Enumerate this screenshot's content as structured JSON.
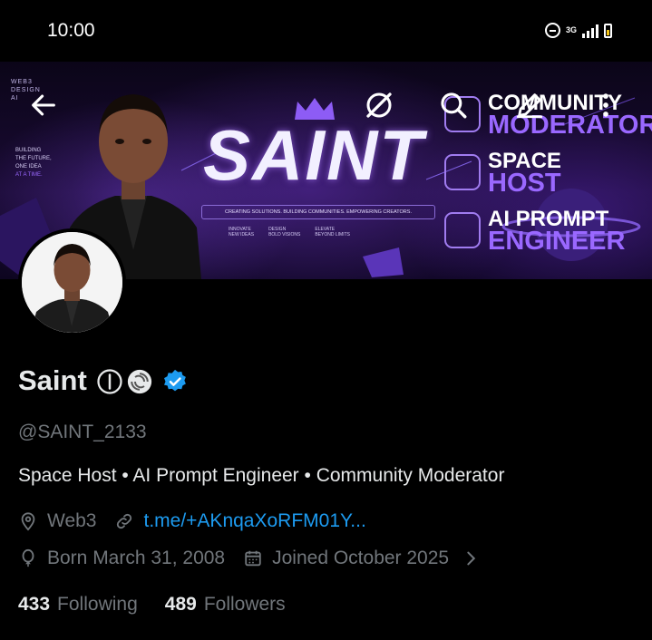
{
  "status_bar": {
    "time": "10:00",
    "network": "3G"
  },
  "banner": {
    "brand_small": [
      "WEB3",
      "DESIGN",
      "AI"
    ],
    "tagline_left": [
      "BUILDING",
      "THE FUTURE,",
      "ONE IDEA",
      "AT A TIME."
    ],
    "title": "SAINT",
    "tagline": "CREATING SOLUTIONS. BUILDING COMMUNITIES. EMPOWERING CREATORS.",
    "features": [
      {
        "top": "INNOVATE",
        "bottom": "NEW IDEAS"
      },
      {
        "top": "DESIGN",
        "bottom": "BOLD VISIONS"
      },
      {
        "top": "ELEVATE",
        "bottom": "BEYOND LIMITS"
      }
    ],
    "roles": [
      {
        "line1": "COMMUNITY",
        "line2": "MODERATOR"
      },
      {
        "line1": "SPACE",
        "line2": "HOST"
      },
      {
        "line1": "AI PROMPT",
        "line2": "ENGINEER"
      }
    ]
  },
  "profile": {
    "display_name": "Saint",
    "handle": "@SAINT_2133",
    "bio": "Space Host • AI Prompt Engineer • Community Moderator",
    "location": "Web3",
    "link": "t.me/+AKnqaXoRFM01Y...",
    "birthday": "Born March 31, 2008",
    "joined": "Joined October 2025",
    "following_count": "433",
    "following_label": "Following",
    "followers_count": "489",
    "followers_label": "Followers"
  },
  "colors": {
    "accent": "#1d9bf0",
    "muted": "#71767b",
    "brand_purple": "#9a68ff"
  },
  "icons": [
    "back-arrow-icon",
    "grok-icon",
    "search-icon",
    "edit-icon",
    "more-vertical-icon",
    "verified-badge-icon",
    "location-icon",
    "link-icon",
    "birthday-balloon-icon",
    "calendar-icon",
    "chevron-right-icon"
  ]
}
